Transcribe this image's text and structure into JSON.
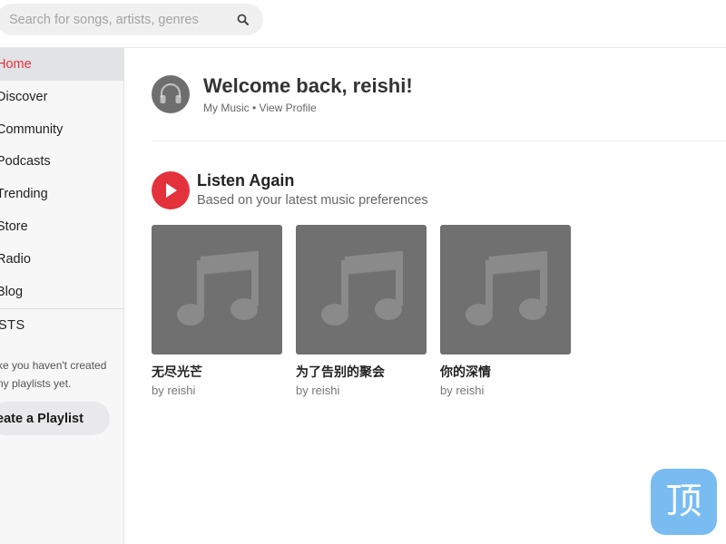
{
  "search": {
    "placeholder": "Search for songs, artists, genres",
    "icon": "search-icon"
  },
  "sidebar": {
    "items": [
      {
        "label": "Home",
        "active": true
      },
      {
        "label": "Discover",
        "active": false
      },
      {
        "label": "Community",
        "active": false
      },
      {
        "label": "Podcasts",
        "active": false
      },
      {
        "label": "Trending",
        "active": false
      },
      {
        "label": "Store",
        "active": false
      },
      {
        "label": "Radio",
        "active": false
      },
      {
        "label": "Blog",
        "active": false
      }
    ],
    "playlists_heading": "STS",
    "empty_note_line1": "ke you haven't created",
    "empty_note_line2": "ny playlists yet.",
    "create_button": "eate a Playlist"
  },
  "header": {
    "welcome": "Welcome back, reishi!",
    "links": "My Music • View Profile"
  },
  "listen_again": {
    "title": "Listen Again",
    "subtitle": "Based on your latest music preferences",
    "cards": [
      {
        "title": "无尽光芒",
        "by": "by reishi"
      },
      {
        "title": "为了告别的聚会",
        "by": "by reishi"
      },
      {
        "title": "你的深情",
        "by": "by reishi"
      }
    ]
  },
  "fab": {
    "glyph": "顶"
  },
  "colors": {
    "accent": "#e4323c",
    "fab": "#78bcf2",
    "art": "#707070"
  }
}
